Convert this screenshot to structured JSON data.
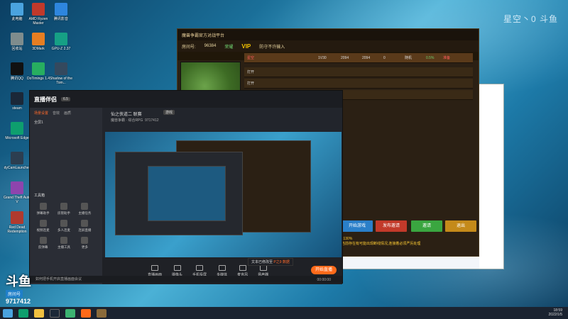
{
  "desktop_icons": [
    {
      "label": "此电脑",
      "color": "#4aa3df"
    },
    {
      "label": "AMD Ryzen Master",
      "color": "#c0392b"
    },
    {
      "label": "腾讯影音",
      "color": "#2e86de"
    },
    {
      "label": "回收站",
      "color": "#7f8c8d"
    },
    {
      "label": "3DMark",
      "color": "#e67e22"
    },
    {
      "label": "GPU-Z 2.37",
      "color": "#16a085"
    },
    {
      "label": "腾讯QQ",
      "color": "#111111"
    },
    {
      "label": "DoTimings 1.4",
      "color": "#27ae60"
    },
    {
      "label": "Shadow of the Tom...",
      "color": "#34495e"
    },
    {
      "label": "steam",
      "color": "#1b2838"
    },
    {
      "label": "Microsoft Edge",
      "color": "#0e9f6e"
    },
    {
      "label": "dyCamLauncher",
      "color": "#2c3e50"
    },
    {
      "label": "Grand Theft Auto V",
      "color": "#8e44ad"
    },
    {
      "label": "Red Dead Redemption",
      "color": "#b03a2e"
    }
  ],
  "brand_overlay": "星空丶0 斗鱼",
  "room": {
    "logo": "斗鱼",
    "tag": "房间号",
    "number": "9717412"
  },
  "game_window": {
    "title": "魔兽争霸官方对战平台",
    "room_label": "房间号:",
    "room_number": "96384",
    "room_name": "荣耀",
    "vip": "VIP",
    "queue": "防守不许输入",
    "columns": [
      "等级",
      "积分",
      "积分",
      "入魔",
      "种族",
      "颜色",
      "经验",
      "状态"
    ],
    "row1": {
      "name": "星空",
      "level": "1V30",
      "score1": "2094",
      "score2": "2094",
      "entry": "0",
      "race": "随机",
      "progress": "0.5%",
      "status": "准备"
    },
    "slots": [
      "打开",
      "打开",
      "打开"
    ],
    "buttons": [
      "开始游戏",
      "发布邀请",
      "邀请",
      "退出"
    ],
    "button_colors": [
      "#2a7fc9",
      "#c23a2a",
      "#3aa640",
      "#c48a1a"
    ],
    "hint": "当前存在有可能出现断线情况,连接着必须严厉处理",
    "percent": "x130%"
  },
  "live_app": {
    "logo": "直播伴侣",
    "version": "6.5",
    "tabs": [
      "场景设置",
      "音效",
      "画质"
    ],
    "scene": "全屏1",
    "stream_title": "仙之侠道二 联赛",
    "tag": "游戏",
    "category": "魔兽争霸 · 综合RPG",
    "stats": "9717412",
    "tool_title": "工具箱",
    "tools": [
      "弹幕助手",
      "房管助手",
      "主播任务",
      "视频连麦",
      "多人连麦",
      "连屏直播",
      "反弹幕",
      "主播工具",
      "更多"
    ],
    "bottom_items": [
      "直播画面",
      "摄像头",
      "手机投屏",
      "多媒体",
      "麦克风",
      "扬声器"
    ],
    "start_button": "开始直播",
    "footer": "如何把手机开启直播画面会议",
    "timer": "00:00:00",
    "tooltip_label": "文本已修改至",
    "tooltip_value": "P之9 数据"
  },
  "taskbar": {
    "time": "18:59",
    "date": "2022/1/5"
  }
}
